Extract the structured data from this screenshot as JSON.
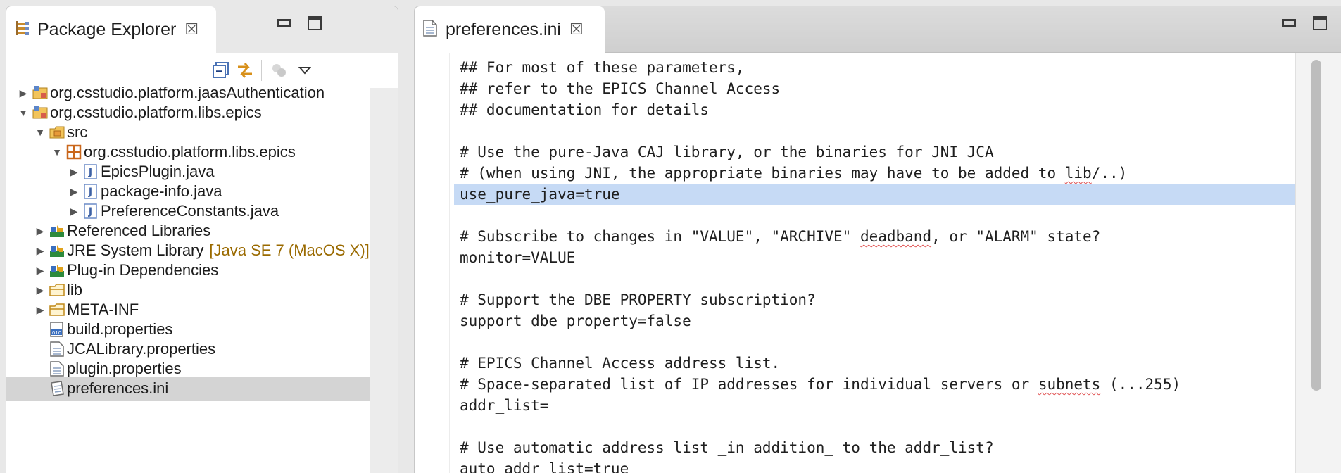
{
  "package_explorer": {
    "tab_label": "Package Explorer",
    "close_glyph": "☒",
    "tree": [
      {
        "label": "org.csstudio.platform.jaasAuthentication",
        "indent": 0,
        "twisty": "▶",
        "icon": "plugin-project-icon"
      },
      {
        "label": "org.csstudio.platform.libs.epics",
        "indent": 0,
        "twisty": "▼",
        "icon": "plugin-project-icon"
      },
      {
        "label": "src",
        "indent": 1,
        "twisty": "▼",
        "icon": "source-folder-icon"
      },
      {
        "label": "org.csstudio.platform.libs.epics",
        "indent": 2,
        "twisty": "▼",
        "icon": "package-icon"
      },
      {
        "label": "EpicsPlugin.java",
        "indent": 3,
        "twisty": "▶",
        "icon": "java-file-icon"
      },
      {
        "label": "package-info.java",
        "indent": 3,
        "twisty": "▶",
        "icon": "java-file-icon"
      },
      {
        "label": "PreferenceConstants.java",
        "indent": 3,
        "twisty": "▶",
        "icon": "java-file-icon"
      },
      {
        "label": "Referenced Libraries",
        "indent": 1,
        "twisty": "▶",
        "icon": "library-icon"
      },
      {
        "label": "JRE System Library",
        "decoration": "[Java SE 7 (MacOS X)]",
        "indent": 1,
        "twisty": "▶",
        "icon": "library-icon"
      },
      {
        "label": "Plug-in Dependencies",
        "indent": 1,
        "twisty": "▶",
        "icon": "library-icon"
      },
      {
        "label": "lib",
        "indent": 1,
        "twisty": "▶",
        "icon": "folder-icon"
      },
      {
        "label": "META-INF",
        "indent": 1,
        "twisty": "▶",
        "icon": "folder-icon"
      },
      {
        "label": "build.properties",
        "indent": 1,
        "twisty": "",
        "icon": "properties-file-icon"
      },
      {
        "label": "JCALibrary.properties",
        "indent": 1,
        "twisty": "",
        "icon": "text-file-icon"
      },
      {
        "label": "plugin.properties",
        "indent": 1,
        "twisty": "",
        "icon": "text-file-icon"
      },
      {
        "label": "preferences.ini",
        "indent": 1,
        "twisty": "",
        "icon": "ini-file-icon",
        "selected": true
      }
    ]
  },
  "editor": {
    "tab_label": "preferences.ini",
    "close_glyph": "☒",
    "highlighted_line_index": 6,
    "lines": [
      "## For most of these parameters,",
      "## refer to the EPICS Channel Access",
      "## documentation for details",
      "",
      "# Use the pure-Java CAJ library, or the binaries for JNI JCA",
      "# (when using JNI, the appropriate binaries may have to be added to lib/..)",
      "use_pure_java=true",
      "",
      "# Subscribe to changes in \"VALUE\", \"ARCHIVE\" deadband, or \"ALARM\" state?",
      "monitor=VALUE",
      "",
      "# Support the DBE_PROPERTY subscription?",
      "support_dbe_property=false",
      "",
      "# EPICS Channel Access address list.",
      "# Space-separated list of IP addresses for individual servers or subnets (...255)",
      "addr_list=",
      "",
      "# Use automatic address list _in addition_ to the addr_list?",
      "auto_addr_list=true"
    ],
    "misspelled_words": [
      "lib",
      "deadband",
      "subnets"
    ]
  },
  "colors": {
    "selection_highlight": "#c6daf5",
    "tree_selection": "#d4d4d4",
    "spell_squiggle": "#e05050"
  }
}
